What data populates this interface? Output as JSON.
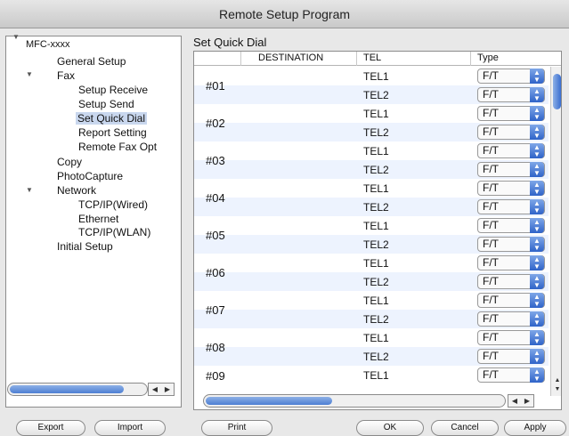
{
  "window": {
    "title": "Remote Setup Program"
  },
  "tree": {
    "items": [
      {
        "label": "MFC-xxxx",
        "expanded": true
      },
      {
        "label": "General Setup"
      },
      {
        "label": "Fax",
        "expanded": true
      },
      {
        "label": "Setup Receive"
      },
      {
        "label": "Setup Send"
      },
      {
        "label": "Set Quick Dial",
        "selected": true
      },
      {
        "label": "Report Setting"
      },
      {
        "label": "Remote Fax Opt"
      },
      {
        "label": "Copy"
      },
      {
        "label": "PhotoCapture"
      },
      {
        "label": "Network",
        "expanded": true
      },
      {
        "label": "TCP/IP(Wired)"
      },
      {
        "label": "Ethernet"
      },
      {
        "label": "TCP/IP(WLAN)"
      },
      {
        "label": "Initial Setup"
      }
    ]
  },
  "panel": {
    "title": "Set Quick Dial"
  },
  "table": {
    "headers": [
      "DESTINATION",
      "TEL",
      "Type"
    ],
    "entries": [
      {
        "num": "#01",
        "tels": [
          "TEL1",
          "TEL2"
        ],
        "types": [
          "F/T",
          "F/T"
        ]
      },
      {
        "num": "#02",
        "tels": [
          "TEL1",
          "TEL2"
        ],
        "types": [
          "F/T",
          "F/T"
        ]
      },
      {
        "num": "#03",
        "tels": [
          "TEL1",
          "TEL2"
        ],
        "types": [
          "F/T",
          "F/T"
        ]
      },
      {
        "num": "#04",
        "tels": [
          "TEL1",
          "TEL2"
        ],
        "types": [
          "F/T",
          "F/T"
        ]
      },
      {
        "num": "#05",
        "tels": [
          "TEL1",
          "TEL2"
        ],
        "types": [
          "F/T",
          "F/T"
        ]
      },
      {
        "num": "#06",
        "tels": [
          "TEL1",
          "TEL2"
        ],
        "types": [
          "F/T",
          "F/T"
        ]
      },
      {
        "num": "#07",
        "tels": [
          "TEL1",
          "TEL2"
        ],
        "types": [
          "F/T",
          "F/T"
        ]
      },
      {
        "num": "#08",
        "tels": [
          "TEL1",
          "TEL2"
        ],
        "types": [
          "F/T",
          "F/T"
        ]
      },
      {
        "num": "#09",
        "tels": [
          "TEL1"
        ],
        "types": [
          "F/T"
        ]
      }
    ]
  },
  "buttons": {
    "export": "Export",
    "import": "Import",
    "print": "Print",
    "ok": "OK",
    "cancel": "Cancel",
    "apply": "Apply"
  }
}
